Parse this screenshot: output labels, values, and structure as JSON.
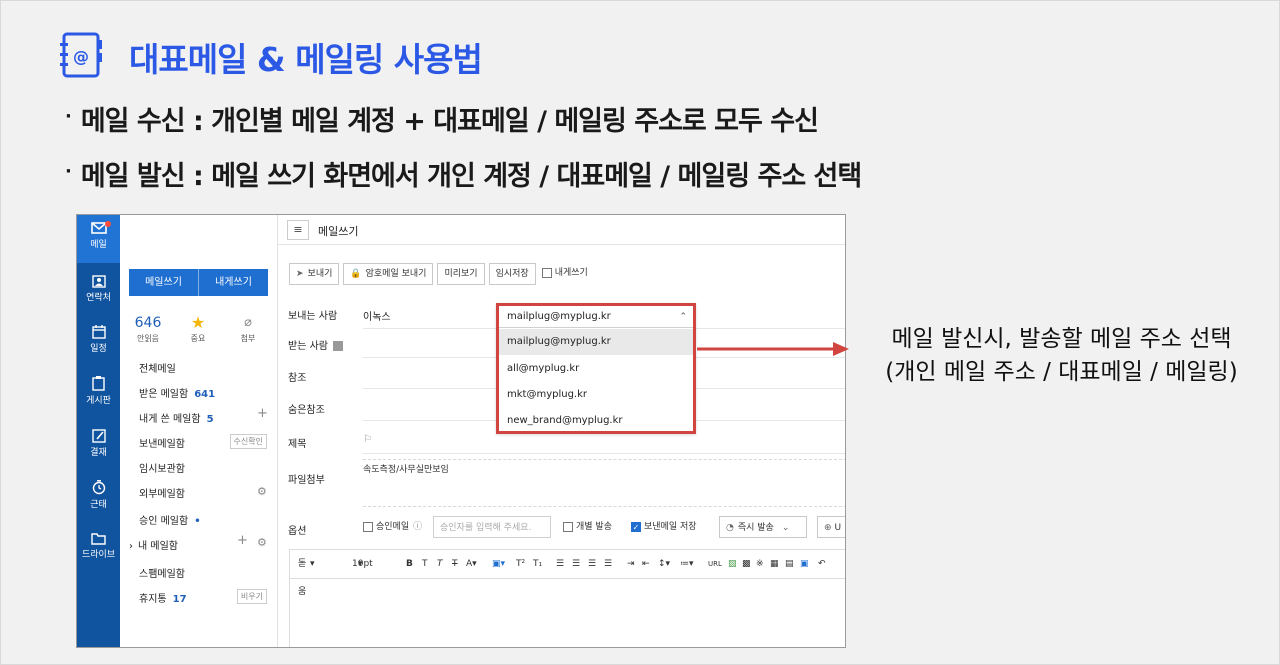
{
  "slide": {
    "title": "대표메일 & 메일링 사용법",
    "bullet1": "메일 수신 : 개인별 메일 계정 + 대표메일 /  메일링 주소로 모두 수신",
    "bullet2": "메일 발신 : 메일 쓰기 화면에서 개인 계정 / 대표메일 / 메일링 주소 선택",
    "bullet_glyph": "·",
    "callout_line1": "메일 발신시, 발송할 메일 주소 선택",
    "callout_line2": "(개인 메일 주소 / 대표메일 / 메일링)",
    "accent_color": "#2b59e6",
    "highlight_color": "#d2443f"
  },
  "rail": {
    "items": [
      {
        "label": "메일",
        "icon": "mail-icon"
      },
      {
        "label": "연락처",
        "icon": "contact-icon"
      },
      {
        "label": "일정",
        "icon": "calendar-icon"
      },
      {
        "label": "게시판",
        "icon": "board-icon"
      },
      {
        "label": "결재",
        "icon": "approval-icon"
      },
      {
        "label": "근태",
        "icon": "clock-icon"
      },
      {
        "label": "드라이브",
        "icon": "folder-icon"
      }
    ]
  },
  "sidebar": {
    "compose_button": "메일쓰기",
    "self_compose_button": "내게쓰기",
    "unread_count": "646",
    "unread_label": "안읽음",
    "important_label": "중요",
    "attach_label": "첨부",
    "folders": [
      {
        "label": "전체메일",
        "count": ""
      },
      {
        "label": "받은 메일함",
        "count": "641"
      },
      {
        "label": "내게 쓴 메일함",
        "count": "5"
      },
      {
        "label": "보낸메일함",
        "count": "",
        "action": "수신확인"
      },
      {
        "label": "임시보관함",
        "count": ""
      },
      {
        "label": "외부메일함",
        "count": ""
      },
      {
        "label": "승인 메일함",
        "count": "•"
      },
      {
        "label": "내 메일함",
        "count": ""
      },
      {
        "label": "스팸메일함",
        "count": ""
      },
      {
        "label": "휴지통",
        "count": "17",
        "action": "비우기"
      }
    ],
    "expand_glyph": "›"
  },
  "compose": {
    "title": "메일쓰기",
    "toolbar": {
      "send": "보내기",
      "secure_send": "암호메일 보내기",
      "preview": "미리보기",
      "save_draft": "임시저장",
      "send_to_self": "내게쓰기"
    },
    "fields": {
      "from_label": "보내는 사람",
      "to_label": "받는 사람",
      "cc_label": "참조",
      "bcc_label": "숨은참조",
      "subject_label": "제목",
      "attach_label": "파일첨부",
      "options_label": "옵션"
    },
    "sender_name": "이녹스",
    "from_select": {
      "selected": "mailplug@myplug.kr",
      "options": [
        "mailplug@myplug.kr",
        "all@myplug.kr",
        "mkt@myplug.kr",
        "new_brand@myplug.kr"
      ]
    },
    "attach_text": "속도측정/사무실만보임",
    "options": {
      "approval_mail": "승인메일",
      "approver_placeholder": "승인자를 입력해 주세요.",
      "individual_send": "개별 발송",
      "save_sent": "보낸메일 저장",
      "send_timing": "즉시 발송",
      "locale_abbr": "U"
    },
    "editor": {
      "font": "돋움",
      "size": "10pt"
    }
  }
}
